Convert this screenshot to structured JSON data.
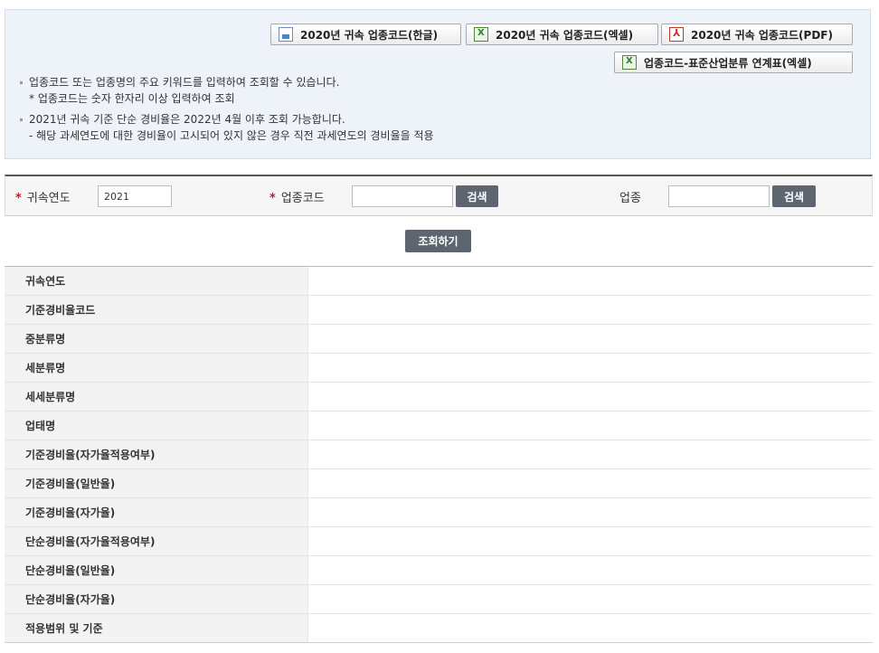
{
  "downloads": [
    {
      "label": "2020년 귀속 업종코드(한글)",
      "icon": "hwp-file-icon"
    },
    {
      "label": "2020년 귀속 업종코드(엑셀)",
      "icon": "excel-file-icon"
    },
    {
      "label": "2020년 귀속 업종코드(PDF)",
      "icon": "pdf-file-icon"
    },
    {
      "label": "업종코드-표준산업분류 연계표(엑셀)",
      "icon": "excel-file-icon"
    }
  ],
  "notes": {
    "n1": "업종코드 또는 업종명의 주요 키워드를 입력하여 조회할 수 있습니다.",
    "n1_sub": "* 업종코드는 숫자 한자리 이상 입력하여 조회",
    "n2": "2021년 귀속 기준 단순 경비율은 2022년 4월 이후 조회 가능합니다.",
    "n2_sub": "- 해당 과세연도에 대한 경비율이 고시되어 있지 않은 경우 직전 과세연도의 경비율을 적용"
  },
  "search": {
    "required_mark": "*",
    "year_label": "귀속연도",
    "year_value": "2021",
    "code_label": "업종코드",
    "code_value": "",
    "code_search_btn": "검색",
    "industry_label": "업종",
    "industry_value": "",
    "industry_search_btn": "검색",
    "submit_btn": "조회하기"
  },
  "result_rows": [
    "귀속연도",
    "기준경비율코드",
    "중분류명",
    "세분류명",
    "세세분류명",
    "업태명",
    "기준경비율(자가율적용여부)",
    "기준경비율(일반율)",
    "기준경비율(자가율)",
    "단순경비율(자가율적용여부)",
    "단순경비율(일반율)",
    "단순경비율(자가율)",
    "적용범위 및 기준"
  ],
  "colors": {
    "accent_required": "#d0102a",
    "dark_button": "#5d6670",
    "info_bg": "#eef3fa"
  }
}
